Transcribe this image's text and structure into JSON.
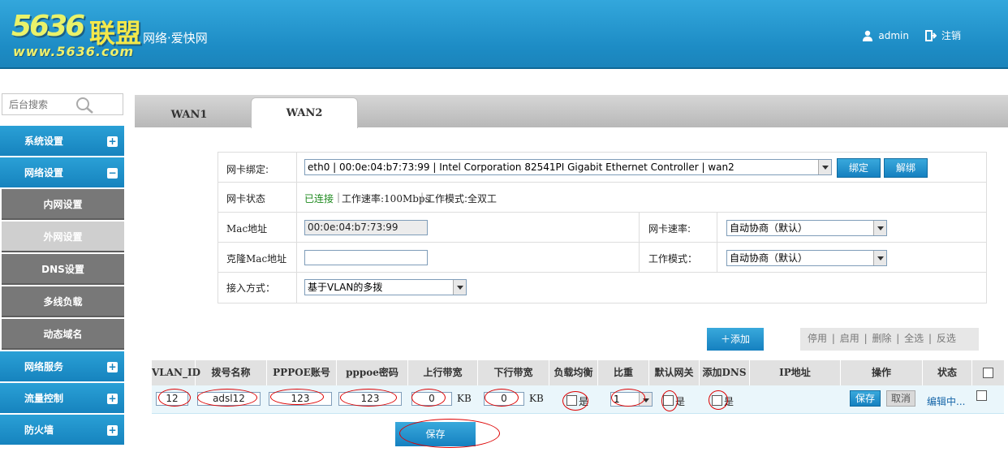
{
  "header": {
    "logo_number": "5636",
    "logo_cn": "联盟",
    "logo_tagline": "网络·爱快网",
    "logo_url": "www.5636.com",
    "user": "admin",
    "logout": "注销"
  },
  "sidebar": {
    "search_placeholder": "后台搜索",
    "menu": [
      {
        "label": "系统设置",
        "toggle": "+"
      },
      {
        "label": "网络设置",
        "toggle": "−"
      },
      {
        "label": "网络服务",
        "toggle": "+"
      },
      {
        "label": "流量控制",
        "toggle": "+"
      },
      {
        "label": "防火墙",
        "toggle": "+"
      }
    ],
    "sub": [
      "内网设置",
      "外网设置",
      "DNS设置",
      "多线负载",
      "动态域名"
    ],
    "active_sub": "外网设置"
  },
  "tabs": {
    "wan1": "WAN1",
    "wan2": "WAN2",
    "active": "WAN2"
  },
  "form": {
    "nic_bind_label": "网卡绑定:",
    "nic_bind_value": "eth0 | 00:0e:04:b7:73:99 | Intel Corporation 82541PI Gigabit Ethernet Controller | wan2",
    "bind_button": "绑定",
    "unbind_button": "解绑",
    "nic_status_label": "网卡状态",
    "status_connected": "已连接",
    "status_sep1": "|",
    "status_speed": "工作速率:100Mbps",
    "status_sep2": "|",
    "status_mode": "工作模式:全双工",
    "mac_label": "Mac地址",
    "mac_value": "00:0e:04:b7:73:99",
    "nic_speed_label": "网卡速率:",
    "nic_speed_value": "自动协商（默认）",
    "clone_mac_label": "克隆Mac地址",
    "clone_mac_value": "",
    "work_mode_label": "工作模式：",
    "work_mode_value": "自动协商（默认）",
    "access_label": "接入方式：",
    "access_value": "基于VLAN的多拨"
  },
  "actions": {
    "add": "＋添加",
    "disable": "停用",
    "enable": "启用",
    "delete": "删除",
    "select_all": "全选",
    "invert": "反选",
    "sep": "|"
  },
  "vlan_table": {
    "headers": [
      "VLAN_ID",
      "拨号名称",
      "PPPOE账号",
      "pppoe密码",
      "上行带宽",
      "下行带宽",
      "负载均衡",
      "比重",
      "默认网关",
      "添加DNS",
      "IP地址",
      "操作",
      "状态"
    ],
    "row": {
      "vlan_id": "12",
      "dial_name": "adsl12",
      "account": "123",
      "password": "123",
      "up": "0",
      "up_unit": "KB",
      "down": "0",
      "down_unit": "KB",
      "lb_label": "是",
      "weight": "1",
      "gw_label": "是",
      "dns_label": "是",
      "ip": "",
      "save": "保存",
      "cancel": "取消",
      "status": "编辑中..."
    }
  },
  "save_button": "保存",
  "colors": {
    "header": "#1d8cc5",
    "menu": "#1683be",
    "sub_menu": "#787878",
    "connected": "#1e8a1e",
    "annotation": "#d00000"
  }
}
